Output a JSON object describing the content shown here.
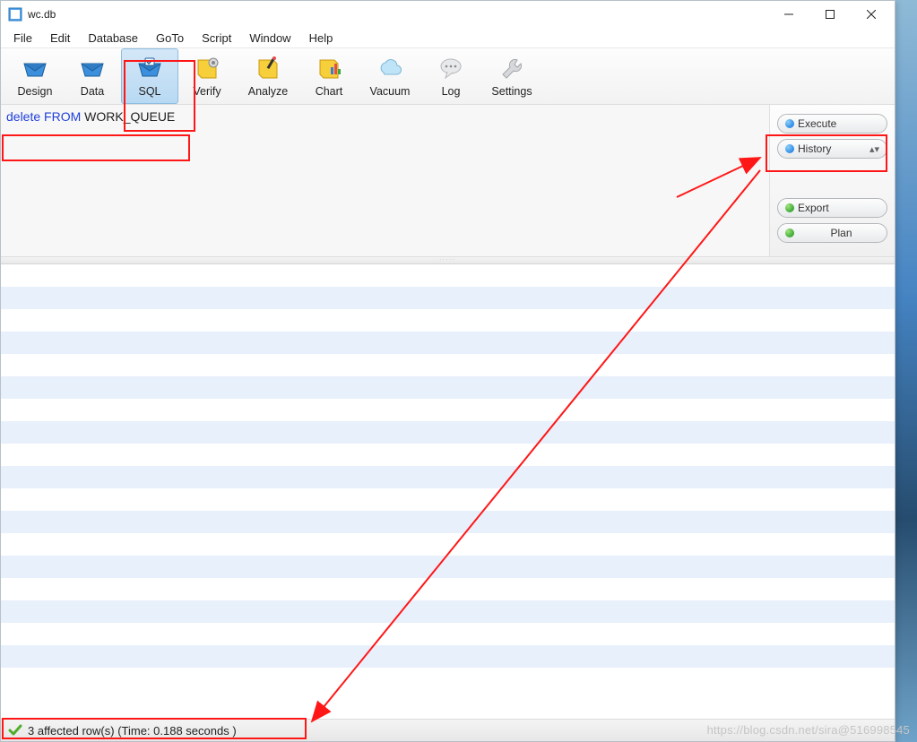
{
  "window": {
    "title": "wc.db"
  },
  "menu": {
    "items": [
      "File",
      "Edit",
      "Database",
      "GoTo",
      "Script",
      "Window",
      "Help"
    ]
  },
  "toolbar": {
    "items": [
      {
        "id": "design",
        "label": "Design",
        "icon": "tray"
      },
      {
        "id": "data",
        "label": "Data",
        "icon": "tray"
      },
      {
        "id": "sql",
        "label": "SQL",
        "icon": "tray-check",
        "selected": true
      },
      {
        "id": "verify",
        "label": "Verify",
        "icon": "tag-gear"
      },
      {
        "id": "analyze",
        "label": "Analyze",
        "icon": "tag-wand"
      },
      {
        "id": "chart",
        "label": "Chart",
        "icon": "tag-chart"
      },
      {
        "id": "vacuum",
        "label": "Vacuum",
        "icon": "cloud"
      },
      {
        "id": "log",
        "label": "Log",
        "icon": "speech"
      },
      {
        "id": "settings",
        "label": "Settings",
        "icon": "wrench"
      }
    ]
  },
  "sql": {
    "keyword_part": "delete FROM",
    "ident_part": " WORK_QUEUE"
  },
  "side": {
    "execute": "Execute",
    "history": "History",
    "export": "Export",
    "plan": "Plan"
  },
  "status": {
    "text": "3 affected row(s) (Time: 0.188 seconds )"
  },
  "watermark": "https://blog.csdn.net/sira@516998545"
}
